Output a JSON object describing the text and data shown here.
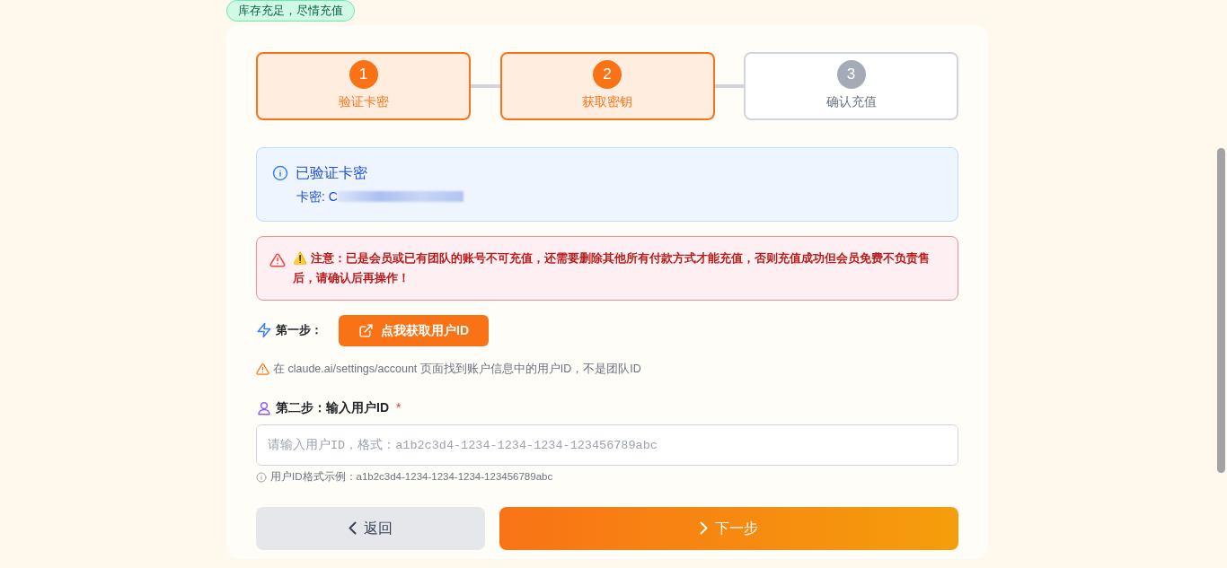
{
  "stock_badge": "库存充足，尽情充值",
  "steps": [
    {
      "number": "1",
      "label": "验证卡密",
      "active": true
    },
    {
      "number": "2",
      "label": "获取密钥",
      "active": true
    },
    {
      "number": "3",
      "label": "确认充值",
      "active": false
    }
  ],
  "info_alert": {
    "title": "已验证卡密",
    "card_key": "卡密: C"
  },
  "warning_alert": {
    "icon_text": "⚠️",
    "label": "注意：",
    "text": "已是会员或已有团队的账号不可充值，还需要删除其他所有付款方式才能充值，否则充值成功但会员免费不负责售后，请确认后再操作！"
  },
  "step_one": {
    "label": "第一步：",
    "button": "点我获取用户ID",
    "hint": "在 claude.ai/settings/account 页面找到账户信息中的用户ID，不是团队ID"
  },
  "step_two": {
    "label": "第二步：输入用户ID",
    "required": true,
    "required_mark": "*",
    "placeholder": "请输入用户ID，格式：a1b2c3d4-1234-1234-1234-123456789abc",
    "help": "用户ID格式示例：a1b2c3d4-1234-1234-1234-123456789abc"
  },
  "buttons": {
    "back": "返回",
    "next": "下一步"
  }
}
